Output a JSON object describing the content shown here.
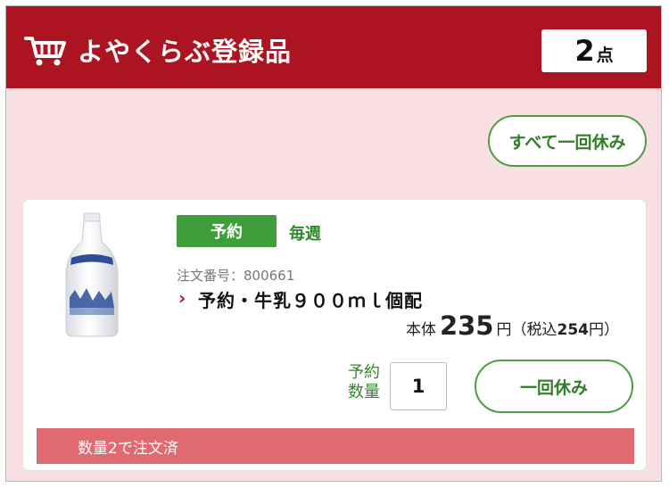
{
  "header": {
    "icon": "cart-icon",
    "title": "よやくらぶ登録品",
    "count": "2",
    "count_unit": "点",
    "bg_color": "#ac1422"
  },
  "actions": {
    "pause_all_label": "すべて一回休み"
  },
  "item": {
    "badge": "予約",
    "frequency": "毎週",
    "order_number": "注文番号：800661",
    "name": "予約・牛乳９００ｍｌ個配",
    "price_prefix": "本体",
    "price": "235",
    "price_unit": "円",
    "tax_open": "（税込",
    "tax_price": "254",
    "tax_close": "円）",
    "qty_label_line1": "予約",
    "qty_label_line2": "数量",
    "quantity": "1",
    "pause_once_label": "一回休み",
    "status": "数量2で注文済",
    "accent_green": "#3f9e3a",
    "status_color": "#e06a70"
  }
}
